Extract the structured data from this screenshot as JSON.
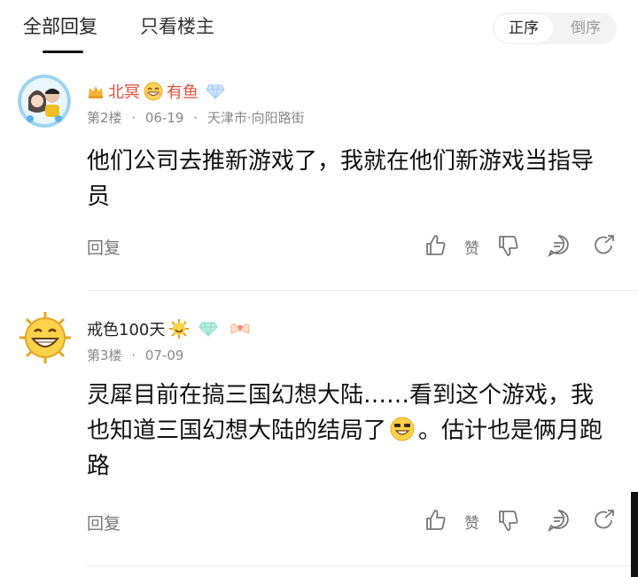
{
  "tabs": {
    "all": "全部回复",
    "owner_only": "只看楼主"
  },
  "order": {
    "asc": "正序",
    "desc": "倒序"
  },
  "comments": [
    {
      "user": "北冥",
      "user_suffix": "有鱼",
      "floor": "第2楼",
      "date": "06-19",
      "location": "天津市·向阳路街",
      "content": "他们公司去推新游戏了，我就在他们新游戏当指导员",
      "reply_label": "回复",
      "like_label": "赞",
      "name_color": "#e0503c"
    },
    {
      "user": "戒色100天",
      "floor": "第3楼",
      "date": "07-09",
      "content_before_emoji": "灵犀目前在搞三国幻想大陆……看到这个游戏，我也知道三国幻想大陆的结局了",
      "content_after_emoji": "。估计也是俩月跑路",
      "reply_label": "回复",
      "like_label": "赞"
    }
  ],
  "separator": "·",
  "icons": [
    "crown-icon",
    "smile-emoji-icon",
    "diamond-badge-icon",
    "sun-emoji-icon",
    "heart-hands-icon",
    "thumb-up-icon",
    "thumb-down-icon",
    "comment-icon",
    "share-icon",
    "grin-emoji-icon"
  ]
}
